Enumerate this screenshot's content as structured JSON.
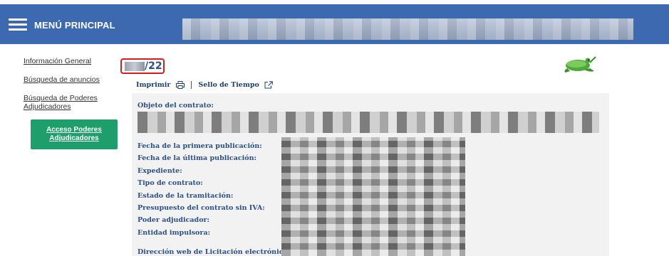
{
  "header": {
    "menu_label": "MENÚ PRINCIPAL",
    "background_color": "#3d69b0",
    "menu_icon": "hamburger-icon"
  },
  "sidebar": {
    "links": [
      {
        "label": "Información General"
      },
      {
        "label": "Búsqueda de anuncios"
      },
      {
        "label": "Búsqueda de Poderes Adjudicadores"
      }
    ],
    "access_button": {
      "label": "Acceso Poderes Adjudicadores",
      "color": "#1e9e6a"
    }
  },
  "record": {
    "id_suffix": "/22",
    "logo_icon": "frog-logo-icon"
  },
  "toolbar": {
    "print_label": "Imprimir",
    "print_icon": "printer-icon",
    "timestamp_label": "Sello de Tiempo",
    "timestamp_icon": "external-link-icon"
  },
  "details": {
    "objeto_label": "Objeto del contrato:",
    "fields": [
      "Fecha de la primera publicación:",
      "Fecha de la última publicación:",
      "Expediente:",
      "Tipo de contrato:",
      "Estado de la tramitación:",
      "Presupuesto del contrato sin IVA:",
      "Poder adjudicador:",
      "Entidad impulsora:"
    ],
    "web_label": "Dirección web de Licitación electrónica:"
  }
}
